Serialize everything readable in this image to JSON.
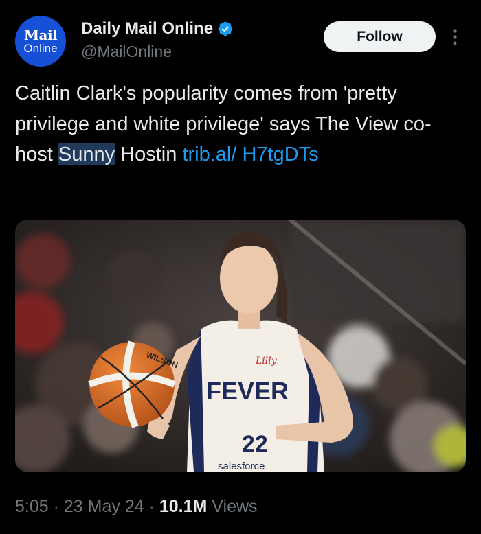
{
  "account": {
    "avatar_line1": "Mail",
    "avatar_line2": "Online",
    "display_name": "Daily Mail Online",
    "handle": "@MailOnline",
    "follow_label": "Follow",
    "avatar_color": "#1550d6",
    "verified_color": "#1d9bf0"
  },
  "tweet": {
    "text_part1": "Caitlin Clark's popularity comes from 'pretty privilege and white privilege' says The View co-host ",
    "text_highlight": "Sunny",
    "text_part2": " Hostin ",
    "link_text": "trib.al/ H7tgDTs",
    "link_color": "#1d9bf0",
    "image": {
      "jersey_team": "FEVER",
      "jersey_number": "22",
      "jersey_sponsor": "Lilly",
      "jersey_bottom_sponsor": "salesforce",
      "ball_brand": "WILSON"
    }
  },
  "meta": {
    "time": "5:05",
    "sep1": " · ",
    "date": "23 May 24",
    "sep2": " · ",
    "views_count": "10.1M",
    "views_label": " Views"
  },
  "icons": [
    "verified-badge-icon",
    "more-options-icon"
  ]
}
